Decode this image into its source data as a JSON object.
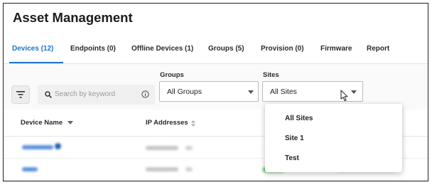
{
  "page": {
    "title": "Asset Management"
  },
  "tabs": [
    {
      "label": "Devices (12)",
      "active": true
    },
    {
      "label": "Endpoints (0)"
    },
    {
      "label": "Offline Devices (1)"
    },
    {
      "label": "Groups (5)"
    },
    {
      "label": "Provision (0)"
    },
    {
      "label": "Firmware"
    },
    {
      "label": "Report"
    }
  ],
  "toolbar": {
    "search_placeholder": "Search by keyword",
    "groups_label": "Groups",
    "groups_value": "All Groups",
    "sites_label": "Sites",
    "sites_value": "All Sites"
  },
  "table": {
    "columns": [
      {
        "label": "Device Name"
      },
      {
        "label": "IP Addresses"
      }
    ]
  },
  "sites_dropdown": {
    "options": [
      "All Sites",
      "Site 1",
      "Test"
    ]
  },
  "icons": {
    "filter": "filter-icon",
    "search": "search-icon",
    "info": "info-icon",
    "sort_down": "sort-down-icon",
    "sort": "sort-icon",
    "cursor": "mouse-pointer-icon"
  },
  "colors": {
    "accent": "#1f73c9",
    "status_green": "#52c452"
  }
}
